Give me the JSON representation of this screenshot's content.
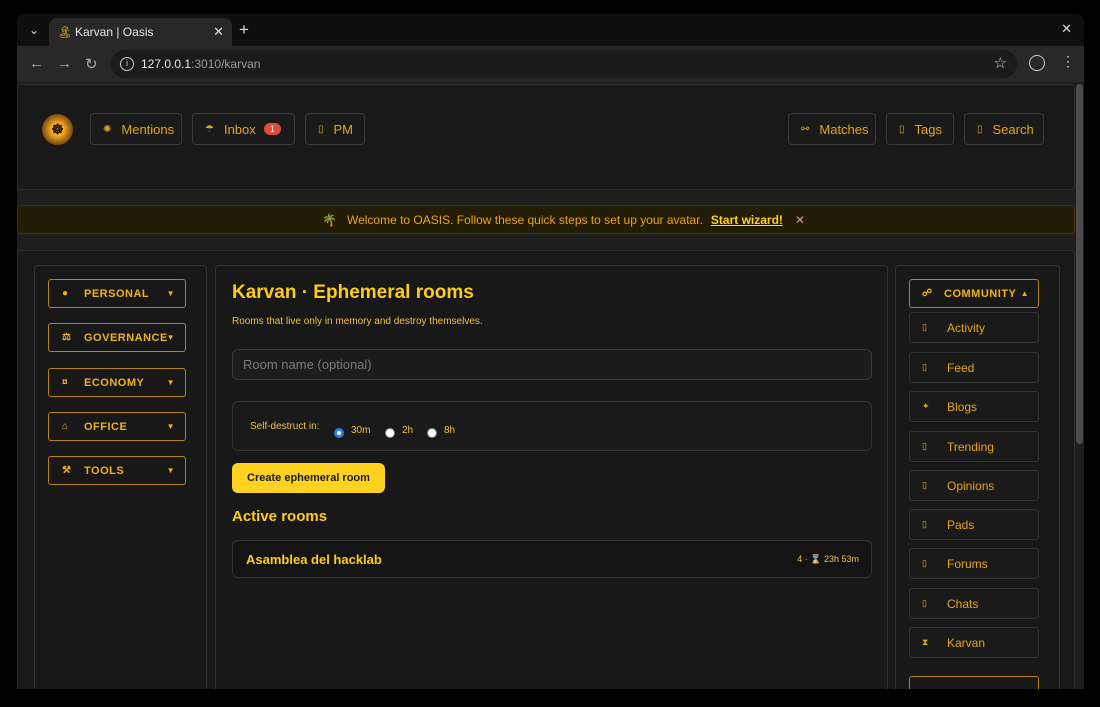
{
  "browser": {
    "tab_title": "Karvan | Oasis",
    "tab_favicon": "palm-tree-icon",
    "url_host": "127.0.0.1",
    "url_path": ":3010/karvan"
  },
  "header": {
    "logo": "oasis-logo",
    "left_buttons": [
      {
        "label": "Mentions",
        "icon": "sun-icon",
        "glyph": "✺"
      },
      {
        "label": "Inbox",
        "icon": "umbrella-icon",
        "glyph": "☂",
        "badge": "1"
      },
      {
        "label": "PM",
        "icon": "box-icon",
        "glyph": "▯"
      }
    ],
    "right_buttons": [
      {
        "label": "Matches",
        "icon": "infinity-icon",
        "glyph": "⚯"
      },
      {
        "label": "Tags",
        "icon": "box-icon",
        "glyph": "▯"
      },
      {
        "label": "Search",
        "icon": "box-icon",
        "glyph": "▯"
      }
    ]
  },
  "banner": {
    "icon": "🌴",
    "text": "Welcome to OASIS. Follow these quick steps to set up your avatar.",
    "link": "Start wizard!",
    "close": "✕"
  },
  "left_menu": [
    {
      "label": "PERSONAL",
      "glyph": "●"
    },
    {
      "label": "GOVERNANCE",
      "glyph": "⚖"
    },
    {
      "label": "ECONOMY",
      "glyph": "¤"
    },
    {
      "label": "OFFICE",
      "glyph": "⌂"
    },
    {
      "label": "TOOLS",
      "glyph": "⚒"
    }
  ],
  "main": {
    "title": "Karvan · Ephemeral rooms",
    "subtitle": "Rooms that live only in memory and destroy themselves.",
    "room_placeholder": "Room name (optional)",
    "self_destruct_label": "Self-destruct in:",
    "durations": [
      {
        "label": "30m",
        "selected": true
      },
      {
        "label": "2h",
        "selected": false
      },
      {
        "label": "8h",
        "selected": false
      }
    ],
    "create_button": "Create ephemeral room",
    "active_title": "Active rooms",
    "rooms": [
      {
        "name": "Asamblea del hacklab",
        "meta": "4 · ⌛ 23h 53m"
      }
    ]
  },
  "right_menu": {
    "header": "COMMUNITY",
    "header_glyph": "☍",
    "items": [
      {
        "label": "Activity",
        "glyph": "▯"
      },
      {
        "label": "Feed",
        "glyph": "▯"
      },
      {
        "label": "Blogs",
        "glyph": "✦"
      },
      {
        "label": "Trending",
        "glyph": "▯"
      },
      {
        "label": "Opinions",
        "glyph": "▯"
      },
      {
        "label": "Pads",
        "glyph": "▯"
      },
      {
        "label": "Forums",
        "glyph": "▯"
      },
      {
        "label": "Chats",
        "glyph": "▯"
      },
      {
        "label": "Karvan",
        "glyph": "⧗"
      }
    ]
  }
}
